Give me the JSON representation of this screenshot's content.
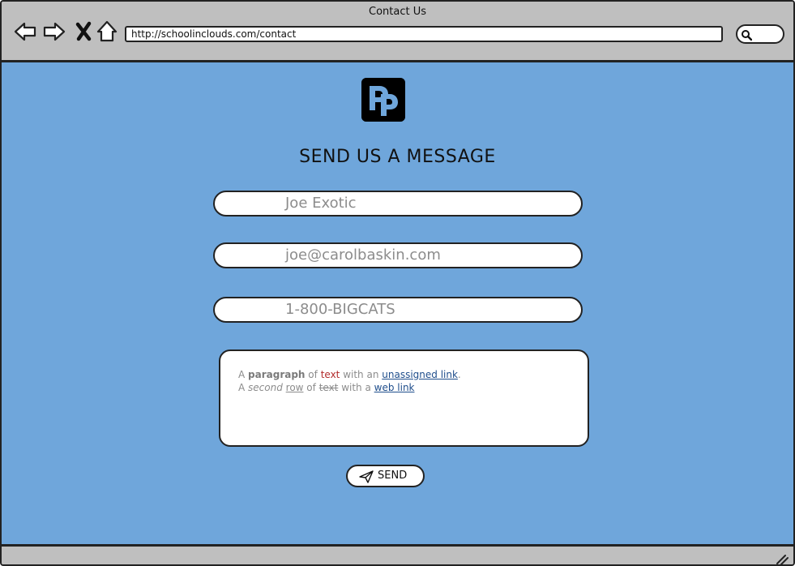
{
  "window": {
    "title": "Contact Us"
  },
  "browser": {
    "nav_icons": [
      "back-arrow-icon",
      "forward-arrow-icon",
      "close-x-icon",
      "home-icon"
    ],
    "url": "http://schoolinclouds.com/contact",
    "search_icon": "search-icon"
  },
  "logo": {
    "glyph": "Pp",
    "bg_color": "#000000",
    "fg_color": "#6fa6db"
  },
  "form": {
    "heading": "SEND US A MESSAGE",
    "name_placeholder": "Joe Exotic",
    "email_placeholder": "joe@carolbaskin.com",
    "phone_placeholder": "1-800-BIGCATS",
    "message": {
      "line1": [
        "A ",
        "paragraph",
        " of ",
        "text",
        " with an ",
        "unassigned link",
        "."
      ],
      "line2": [
        "A ",
        "second",
        " ",
        "row",
        " of ",
        "text",
        " with a ",
        "web link"
      ]
    },
    "send_label": "SEND",
    "send_icon": "paper-plane-icon"
  },
  "colors": {
    "content_bg": "#6fa6db",
    "chrome_bg": "#bfbfbf",
    "link": "#1f4e8c",
    "red_text": "#b22b2b"
  }
}
